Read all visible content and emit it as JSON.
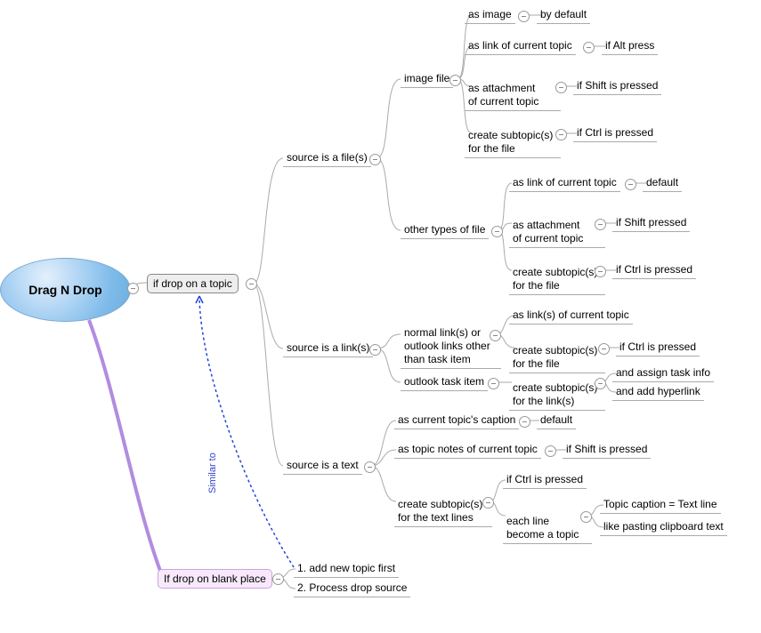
{
  "root": {
    "label": "Drag N Drop"
  },
  "dropTopic": {
    "label": "if drop on a topic"
  },
  "dropBlank": {
    "label": "If drop on blank place"
  },
  "blankSteps": {
    "step1": "1. add new topic first",
    "step2": "2. Process drop source"
  },
  "relLabel": "Similar to",
  "srcFile": {
    "label": "source is a file(s)"
  },
  "srcLink": {
    "label": "source is a link(s)"
  },
  "srcText": {
    "label": "source is a text"
  },
  "imageFile": {
    "label": "image file"
  },
  "otherFile": {
    "label": "other types of file"
  },
  "img_asImage": "as image",
  "img_asImage_cond": "by default",
  "img_asLink": "as link of current topic",
  "img_asLink_cond": "if Alt press",
  "img_asAttach": "as attachment\nof current topic",
  "img_asAttach_cond": "if Shift is pressed",
  "img_subtopic": "create subtopic(s)\nfor the file",
  "img_subtopic_cond": "if Ctrl is pressed",
  "other_asLink": "as link of current topic",
  "other_asLink_cond": "default",
  "other_asAttach": "as attachment\nof current topic",
  "other_asAttach_cond": "if Shift pressed",
  "other_subtopic": "create subtopic(s)\nfor the file",
  "other_subtopic_cond": "if Ctrl is pressed",
  "normalLink": "normal link(s) or\noutlook links other\nthan task item",
  "nl_asLink": "as link(s) of current topic",
  "nl_subtopic": "create subtopic(s)\nfor the file",
  "nl_subtopic_cond": "if Ctrl is pressed",
  "outlookTask": "outlook task item",
  "ot_subtopic": "create subtopic(s)\nfor the link(s)",
  "ot_assign": "and assign task info",
  "ot_hyperlink": "and add hyperlink",
  "txt_caption": "as current topic's caption",
  "txt_caption_cond": "default",
  "txt_notes": "as topic notes of current topic",
  "txt_notes_cond": "if Shift is pressed",
  "txt_subtopic": "create subtopic(s)\nfor the text lines",
  "txt_sub_ctrl": "if Ctrl is pressed",
  "txt_sub_each": "each line\nbecome a topic",
  "txt_each_caption": "Topic caption = Text line",
  "txt_each_paste": "like pasting clipboard text"
}
